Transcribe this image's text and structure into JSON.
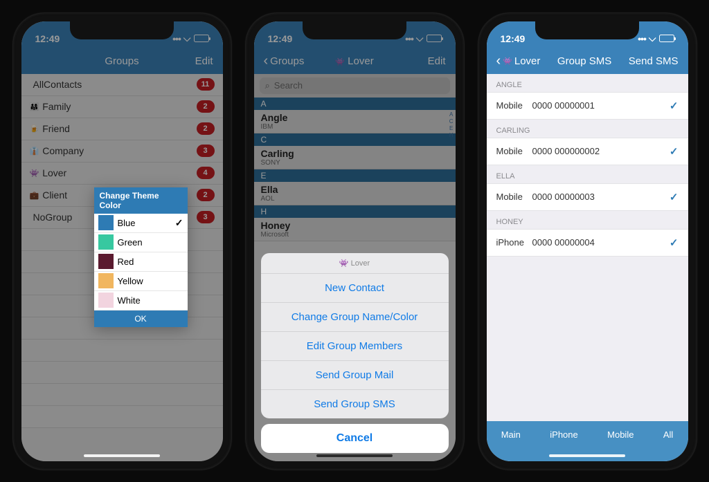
{
  "status": {
    "time": "12:49"
  },
  "screen1": {
    "nav": {
      "title": "Groups",
      "edit": "Edit"
    },
    "groups": [
      {
        "icon": "",
        "name": "AllContacts",
        "count": "11"
      },
      {
        "icon": "👨‍👩‍👧",
        "name": "Family",
        "count": "2"
      },
      {
        "icon": "🍺",
        "name": "Friend",
        "count": "2"
      },
      {
        "icon": "👔",
        "name": "Company",
        "count": "3"
      },
      {
        "icon": "👾",
        "name": "Lover",
        "count": "4"
      },
      {
        "icon": "💼",
        "name": "Client",
        "count": "2"
      },
      {
        "icon": "",
        "name": "NoGroup",
        "count": "3"
      }
    ],
    "popup": {
      "title": "Change Theme Color",
      "options": [
        {
          "label": "Blue",
          "color": "#2e7bb4",
          "selected": true
        },
        {
          "label": "Green",
          "color": "#37c8a0",
          "selected": false
        },
        {
          "label": "Red",
          "color": "#5a1a2f",
          "selected": false
        },
        {
          "label": "Yellow",
          "color": "#f1b65f",
          "selected": false
        },
        {
          "label": "White",
          "color": "#f2d4df",
          "selected": false
        }
      ],
      "ok": "OK"
    }
  },
  "screen2": {
    "nav": {
      "back": "Groups",
      "title": "Lover",
      "edit": "Edit"
    },
    "search_placeholder": "Search",
    "sections": [
      {
        "letter": "A",
        "name": "Angle",
        "sub": "IBM"
      },
      {
        "letter": "C",
        "name": "Carling",
        "sub": "SONY"
      },
      {
        "letter": "E",
        "name": "Ella",
        "sub": "AOL"
      },
      {
        "letter": "H",
        "name": "Honey",
        "sub": "Microsoft"
      }
    ],
    "sheet": {
      "title": "Lover",
      "items": [
        "New Contact",
        "Change Group Name/Color",
        "Edit Group Members",
        "Send Group Mail",
        "Send Group SMS"
      ],
      "cancel": "Cancel"
    }
  },
  "screen3": {
    "nav": {
      "back": "Lover",
      "title": "Group SMS",
      "action": "Send SMS"
    },
    "entries": [
      {
        "header": "ANGLE",
        "type": "Mobile",
        "number": "0000 00000001"
      },
      {
        "header": "CARLING",
        "type": "Mobile",
        "number": "0000 000000002"
      },
      {
        "header": "ELLA",
        "type": "Mobile",
        "number": "0000 00000003"
      },
      {
        "header": "HONEY",
        "type": "iPhone",
        "number": "0000 00000004"
      }
    ],
    "tabs": [
      "Main",
      "iPhone",
      "Mobile",
      "All"
    ]
  }
}
